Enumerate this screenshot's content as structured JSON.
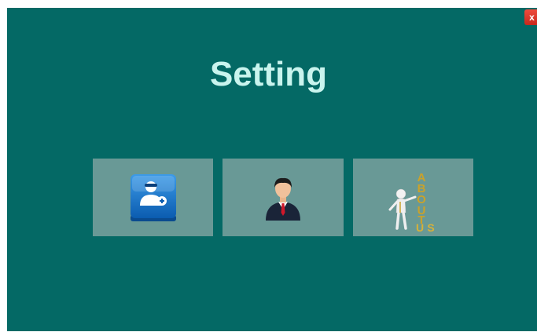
{
  "window": {
    "title": "Setting",
    "close_label": "x"
  },
  "tiles": [
    {
      "icon": "add-user-icon"
    },
    {
      "icon": "businessman-icon"
    },
    {
      "icon": "about-us-icon",
      "text": "ABOUT US"
    }
  ],
  "colors": {
    "background": "#046965",
    "tile": "#699996",
    "title": "#c9f4ee",
    "close": "#e0392b"
  }
}
